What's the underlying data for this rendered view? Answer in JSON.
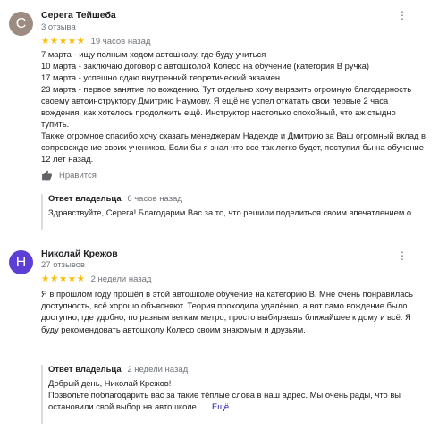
{
  "reviews": [
    {
      "avatar_letter": "С",
      "avatar_color": "#9c8b80",
      "author": "Серега Тейшеба",
      "review_count": "3 отзыва",
      "stars": "★★★★★",
      "rating": 5,
      "time": "19 часов назад",
      "lines": [
        "7 марта - ищу полным ходом автошколу, где буду учиться",
        "10 марта - заключаю договор с автошколой Колесо на обучение (категория В ручка)",
        "17 марта - успешно сдаю внутренний теоретический экзамен.",
        "23 марта - первое занятие по вождению. Тут отдельно хочу выразить огромную благодарность",
        "своему автоинструктору Дмитрию Наумову. Я ещё не успел откатать свои первые 2 часа",
        "вождения, как хотелось продолжить ещё. Инструктор настолько спокойный, что аж стыдно",
        "тупить.",
        "Также огромное спасибо хочу сказать менеджерам Надежде и Дмитрию за Ваш огромный вклад в",
        "сопровождение своих учеников. Если бы я знал что все так легко будет, поступил бы на обучение",
        "12 лет назад."
      ],
      "like_label": "Нравится",
      "reply": {
        "label": "Ответ владельца",
        "time": "6 часов назад",
        "lines": [
          "Здравствуйте, Серега! Благодарим Вас за то, что решили поделиться своим впечатлением о"
        ]
      }
    },
    {
      "avatar_letter": "Н",
      "avatar_color": "#5b3fd6",
      "author": "Николай Крежов",
      "review_count": "27 отзывов",
      "stars": "★★★★★",
      "rating": 5,
      "time": "2 недели назад",
      "lines": [
        "Я в прошлом году прошёл в этой автошколе обучение на категорию В. Мне очень понравилась",
        "доступность, всё хорошо объясняют. Теория проходила удалённо, а вот само вождение было",
        "доступно, где удобно, по разным веткам метро, просто выбираешь ближайшее к дому и всё. Я",
        "буду рекомендовать автошколу Колесо своим знакомым и друзьям."
      ],
      "reply": {
        "label": "Ответ владельца",
        "time": "2 недели назад",
        "lines": [
          "Добрый день, Николай Крежов!",
          "Позвольте поблагодарить вас за такие тёплые слова в наш адрес. Мы очень рады, что вы",
          "остановили свой выбор на автошколе. …"
        ],
        "more_label": "Ещё"
      }
    }
  ],
  "icons": {
    "more": "more-vertical-icon",
    "like": "thumb-up-icon"
  }
}
